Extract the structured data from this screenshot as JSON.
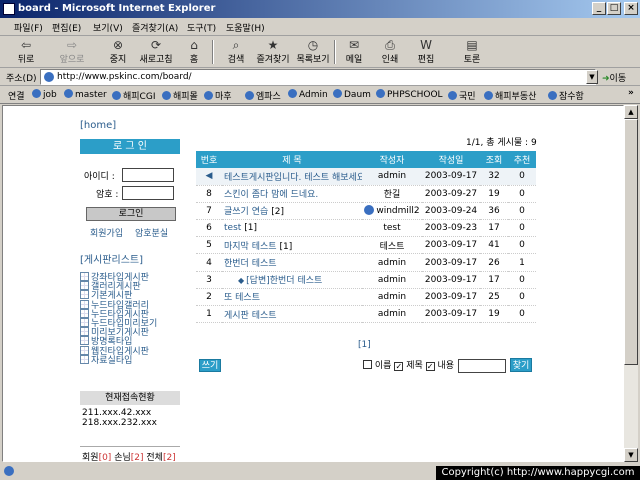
{
  "window": {
    "title": "board - Microsoft Internet Explorer"
  },
  "menu": [
    "파일(F)",
    "편집(E)",
    "보기(V)",
    "즐겨찾기(A)",
    "도구(T)",
    "도움말(H)"
  ],
  "toolbar": {
    "back": "뒤로",
    "forward": "앞으로",
    "stop": "중지",
    "refresh": "새로고침",
    "home": "홈",
    "search": "검색",
    "favorites": "즐겨찾기",
    "history": "목록보기",
    "mail": "메일",
    "print": "인쇄",
    "edit": "편집",
    "discuss": "토론"
  },
  "address": {
    "label": "주소(D)",
    "url": "http://www.pskinc.com/board/",
    "go": "이동"
  },
  "links": {
    "label": "연결",
    "items": [
      "job",
      "master",
      "해피CGI",
      "해피몰",
      "마후",
      "엠파스",
      "Admin",
      "Daum",
      "PHPSCHOOL",
      "국민",
      "해피부동산",
      "잠수함"
    ]
  },
  "left": {
    "home": "[home]",
    "login_title": "로 그 인",
    "id_label": "아이디 :",
    "pw_label": "암호 :",
    "login_button": "로그인",
    "join": "회원가입",
    "lost_pw": "암호분실",
    "boardlist_title": "[게시판리스트]",
    "boards": [
      "강좌타입게시판",
      "갤러리게시판",
      "기본게시판",
      "누드타입갤러리",
      "누드타입게시판",
      "누드타입미리보기",
      "미리보기게시판",
      "방명록타입",
      "웹진타입게시판",
      "자료실타입"
    ],
    "visitor_title": "현재접속현황",
    "visitor_ips": [
      "211.xxx.42.xxx",
      "218.xxx.232.xxx"
    ],
    "stats": {
      "member_label": "회원",
      "member_count": "[0]",
      "guest_label": "손님",
      "guest_count": "[2]",
      "total_label": "전체",
      "total_count": "[2]"
    }
  },
  "board": {
    "page_info": "1/1, 총 게시물 : 9",
    "headers": [
      "번호",
      "제 목",
      "작성자",
      "작성일",
      "조회",
      "추천"
    ],
    "rows": [
      {
        "no": "",
        "title": "테스트게시판입니다. 테스트 해보세요",
        "comments": "",
        "author": "admin",
        "date": "2003-09-17",
        "views": "32",
        "votes": "0",
        "notice": true,
        "reply": false,
        "ie": false
      },
      {
        "no": "8",
        "title": "스킨이 좀다 맘에 드네요.",
        "comments": "",
        "author": "한길",
        "date": "2003-09-27",
        "views": "19",
        "votes": "0",
        "notice": false,
        "reply": false,
        "ie": false
      },
      {
        "no": "7",
        "title": "글쓰기 연습",
        "comments": "[2]",
        "author": "windmill2",
        "date": "2003-09-24",
        "views": "36",
        "votes": "0",
        "notice": false,
        "reply": false,
        "ie": true
      },
      {
        "no": "6",
        "title": "test",
        "comments": "[1]",
        "author": "test",
        "date": "2003-09-23",
        "views": "17",
        "votes": "0",
        "notice": false,
        "reply": false,
        "ie": false
      },
      {
        "no": "5",
        "title": "마지막 테스트",
        "comments": "[1]",
        "author": "테스트",
        "date": "2003-09-17",
        "views": "41",
        "votes": "0",
        "notice": false,
        "reply": false,
        "ie": false
      },
      {
        "no": "4",
        "title": "한번더 테스트",
        "comments": "",
        "author": "admin",
        "date": "2003-09-17",
        "views": "26",
        "votes": "1",
        "notice": false,
        "reply": false,
        "ie": false
      },
      {
        "no": "3",
        "title": "[답변]한번더 테스트",
        "comments": "",
        "author": "admin",
        "date": "2003-09-17",
        "views": "17",
        "votes": "0",
        "notice": false,
        "reply": true,
        "ie": false
      },
      {
        "no": "2",
        "title": "또 테스트",
        "comments": "",
        "author": "admin",
        "date": "2003-09-17",
        "views": "25",
        "votes": "0",
        "notice": false,
        "reply": false,
        "ie": false
      },
      {
        "no": "1",
        "title": "게시판 테스트",
        "comments": "",
        "author": "admin",
        "date": "2003-09-17",
        "views": "19",
        "votes": "0",
        "notice": false,
        "reply": false,
        "ie": false
      }
    ],
    "pager": "[1]",
    "write_button": "쓰기",
    "search": {
      "opt_name": "이름",
      "opt_subject": "제목",
      "opt_content": "내용",
      "name_checked": false,
      "subject_checked": true,
      "content_checked": true,
      "button": "찾기"
    }
  },
  "status": {
    "copyright": "Copyright(c) http://www.happycgi.com"
  },
  "colors": {
    "accent": "#2c9ec8",
    "link": "#2a5c8c",
    "titlebar": "#0a246a"
  }
}
